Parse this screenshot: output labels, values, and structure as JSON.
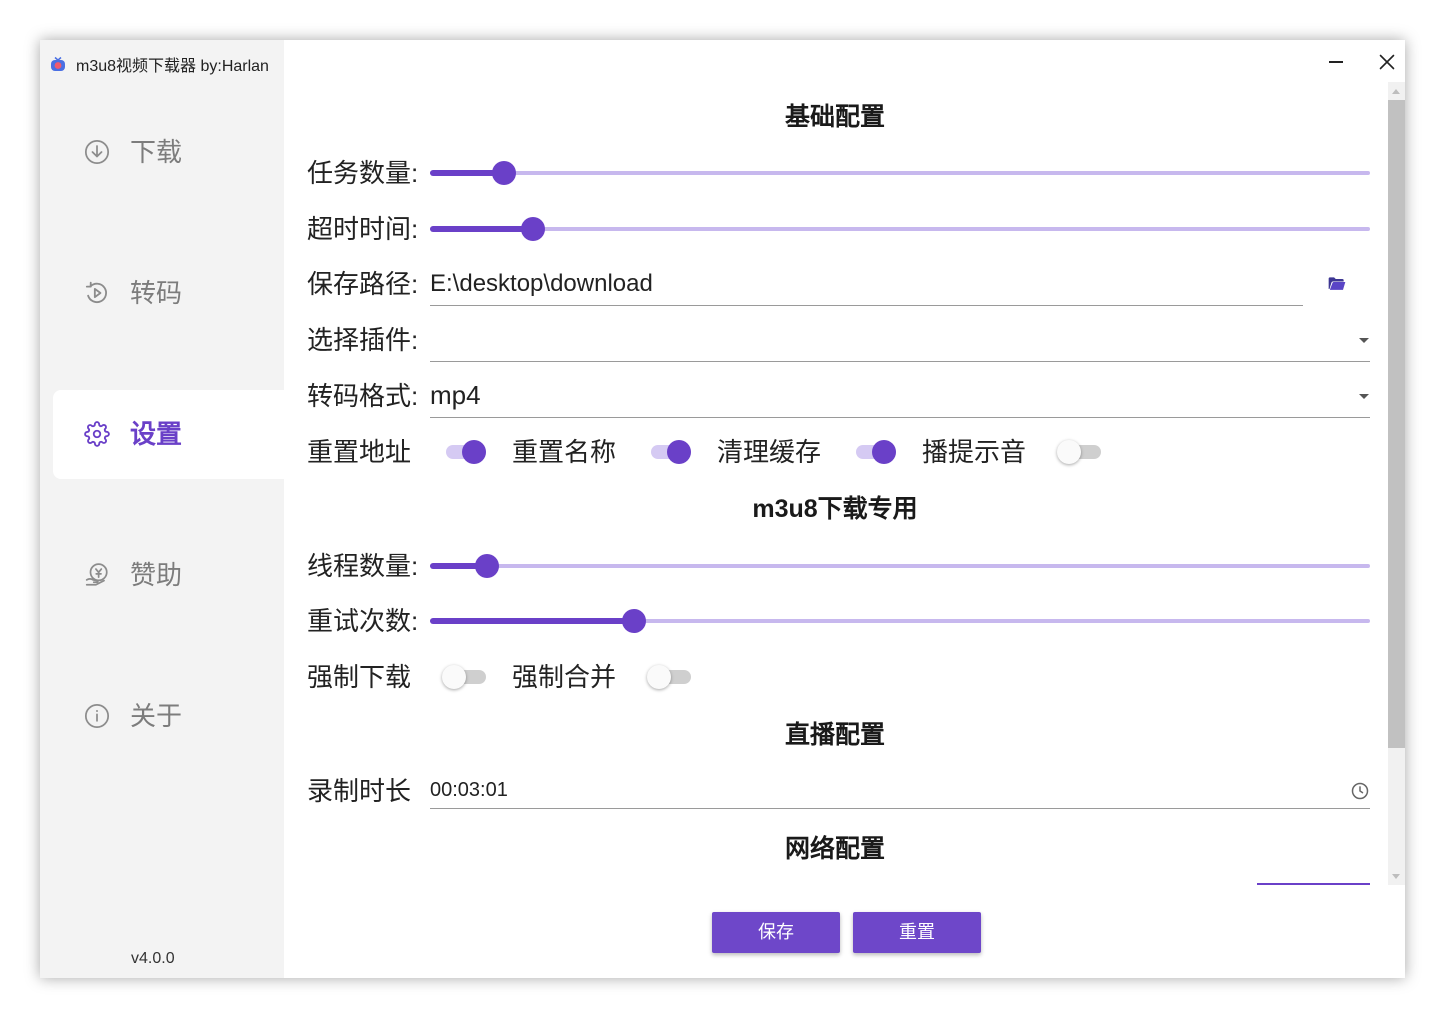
{
  "window": {
    "title": "m3u8视频下载器 by:Harlan",
    "app_icon": "app-icon",
    "minimize_icon": "minimize-icon",
    "close_icon": "close-icon"
  },
  "theme": {
    "accent": "#6a40c8",
    "accent_light": "#c7b8ee",
    "toggle_on_track": "#d5caf3",
    "toggle_off_track": "#cfcfcf",
    "sidebar_bg": "#f3f3f3",
    "button_bg": "#6e47c9"
  },
  "sidebar": {
    "items": [
      {
        "label": "下载",
        "icon": "download-icon",
        "selected": false
      },
      {
        "label": "转码",
        "icon": "transcode-icon",
        "selected": false
      },
      {
        "label": "设置",
        "icon": "gear-icon",
        "selected": true
      },
      {
        "label": "赞助",
        "icon": "donate-icon",
        "selected": false
      },
      {
        "label": "关于",
        "icon": "info-icon",
        "selected": false
      }
    ],
    "version": "v4.0.0"
  },
  "settings": {
    "basic": {
      "heading": "基础配置",
      "task_count": {
        "label": "任务数量:",
        "level": 0.079
      },
      "timeout": {
        "label": "超时时间:",
        "level": 0.11
      },
      "save_path": {
        "label": "保存路径:",
        "value": "E:\\desktop\\download",
        "icon": "folder-open-icon"
      },
      "plugin": {
        "label": "选择插件:",
        "value": "",
        "icon": "chevron-down-icon"
      },
      "format": {
        "label": "转码格式:",
        "value": "mp4",
        "icon": "chevron-down-icon"
      },
      "toggles": [
        {
          "label": "重置地址",
          "on": true
        },
        {
          "label": "重置名称",
          "on": true
        },
        {
          "label": "清理缓存",
          "on": true
        },
        {
          "label": "播提示音",
          "on": false
        }
      ]
    },
    "m3u8": {
      "heading": "m3u8下载专用",
      "threads": {
        "label": "线程数量:",
        "level": 0.061
      },
      "retries": {
        "label": "重试次数:",
        "level": 0.217
      },
      "toggles": [
        {
          "label": "强制下载",
          "on": false
        },
        {
          "label": "强制合并",
          "on": false
        }
      ]
    },
    "live": {
      "heading": "直播配置",
      "duration": {
        "label": "录制时长",
        "value": "00:03:01",
        "icon": "clock-icon"
      }
    },
    "network": {
      "heading": "网络配置"
    }
  },
  "actions": {
    "save_label": "保存",
    "reset_label": "重置"
  }
}
